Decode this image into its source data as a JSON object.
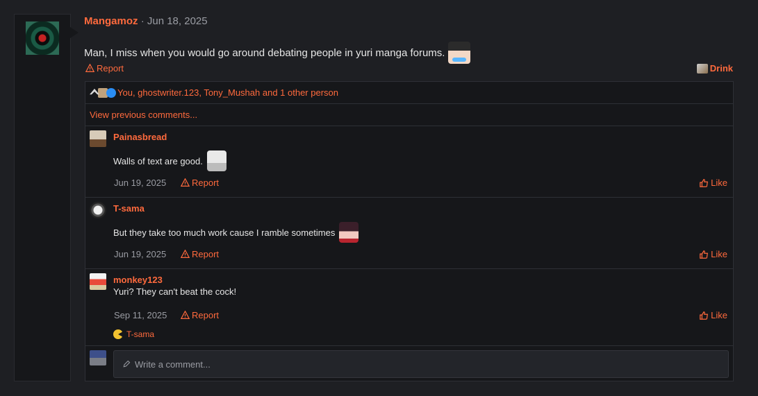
{
  "post": {
    "author": "Mangamoz",
    "separator": "·",
    "date": "Jun 18, 2025",
    "body": "Man, I miss when you would go around debating people in yuri manga forums.",
    "report_label": "Report",
    "drink_label": "Drink"
  },
  "reactions": {
    "summary": "You, ghostwriter.123, Tony_Mushah and 1 other person"
  },
  "comments_section": {
    "view_previous": "View previous comments...",
    "items": [
      {
        "author": "Painasbread",
        "text": "Walls of text are good.",
        "date": "Jun 19, 2025",
        "report": "Report",
        "like": "Like"
      },
      {
        "author": "T-sama",
        "text": "But they take too much work cause I ramble sometimes",
        "date": "Jun 19, 2025",
        "report": "Report",
        "like": "Like"
      },
      {
        "author": "monkey123",
        "text": "Yuri? They can't beat the cock!",
        "date": "Sep 11, 2025",
        "report": "Report",
        "like": "Like",
        "reaction_user": "T-sama"
      }
    ],
    "reply_placeholder": "Write a comment..."
  },
  "icons": [
    "warning-icon",
    "drink-icon",
    "thumbs-up-icon",
    "pencil-icon",
    "upvote-icon",
    "like-reaction-icon"
  ],
  "colors": {
    "accent": "#ff6a3d",
    "background": "#1e1f23",
    "panel": "#16171a"
  }
}
